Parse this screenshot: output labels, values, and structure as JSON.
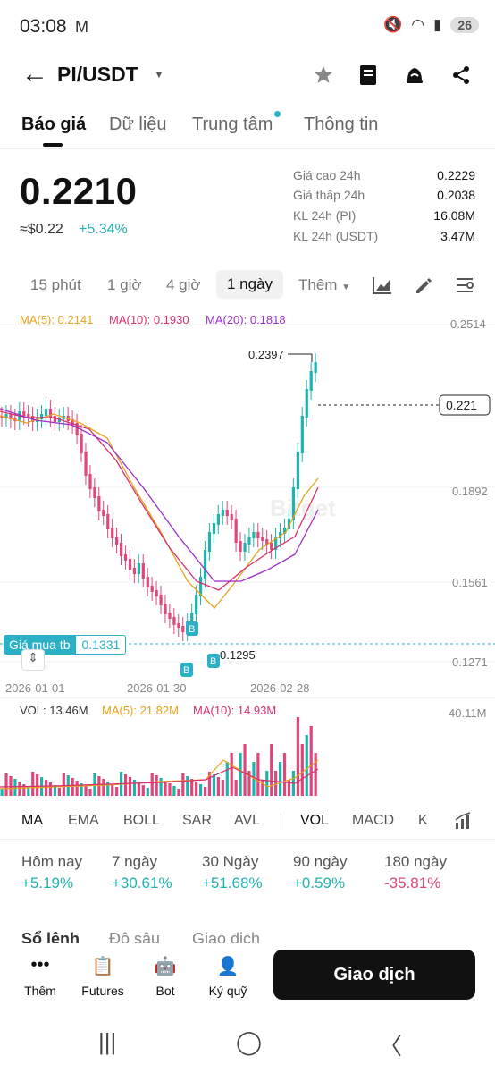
{
  "status": {
    "time": "03:08",
    "carrier_icon": "M",
    "battery": "26"
  },
  "header": {
    "pair": "PI/USDT"
  },
  "tabs": [
    "Báo giá",
    "Dữ liệu",
    "Trung tâm",
    "Thông tin"
  ],
  "price": {
    "last": "0.2210",
    "usd": "≈$0.22",
    "change": "+5.34%"
  },
  "stats": [
    {
      "label": "Giá cao 24h",
      "value": "0.2229"
    },
    {
      "label": "Giá thấp 24h",
      "value": "0.2038"
    },
    {
      "label": "KL 24h (PI)",
      "value": "16.08M"
    },
    {
      "label": "KL 24h (USDT)",
      "value": "3.47M"
    }
  ],
  "intervals": [
    "15 phút",
    "1 giờ",
    "4 giờ",
    "1 ngày",
    "Thêm"
  ],
  "ma": {
    "ma5": "MA(5): 0.2141",
    "ma10": "MA(10): 0.1930",
    "ma20": "MA(20): 0.1818"
  },
  "chart_labels": {
    "y_ticks": [
      "0.2514",
      "0.1892",
      "0.1561",
      "0.1271"
    ],
    "current": "0.221",
    "high": "0.2397",
    "low": "0.1295",
    "avg_buy_label": "Giá mua tb",
    "avg_buy_value": "0.1331",
    "x_ticks": [
      "2026-01-01",
      "2026-01-30",
      "2026-02-28"
    ],
    "marker": "B",
    "watermark": "Bitget"
  },
  "volume": {
    "vol": "VOL: 13.46M",
    "ma5": "MA(5): 21.82M",
    "ma10": "MA(10): 14.93M",
    "max": "40.11M"
  },
  "indicators": [
    "MA",
    "EMA",
    "BOLL",
    "SAR",
    "AVL",
    "VOL",
    "MACD",
    "K"
  ],
  "performance": [
    {
      "label": "Hôm nay",
      "value": "+5.19%"
    },
    {
      "label": "7 ngày",
      "value": "+30.61%"
    },
    {
      "label": "30 Ngày",
      "value": "+51.68%"
    },
    {
      "label": "90 ngày",
      "value": "+0.59%"
    },
    {
      "label": "180 ngày",
      "value": "-35.81%"
    }
  ],
  "bottom_tabs": [
    "Sổ lệnh",
    "Độ sâu",
    "Giao dịch"
  ],
  "bottom_bar": [
    {
      "label": "Thêm",
      "icon": "more-icon"
    },
    {
      "label": "Futures",
      "icon": "futures-icon"
    },
    {
      "label": "Bot",
      "icon": "bot-icon"
    },
    {
      "label": "Ký quỹ",
      "icon": "margin-icon"
    }
  ],
  "trade_button": "Giao dịch",
  "colors": {
    "up": "#1fb3b0",
    "down": "#e0457b",
    "ma5": "#e8a31a",
    "ma10": "#d6306e",
    "ma20": "#9b2ec9"
  }
}
